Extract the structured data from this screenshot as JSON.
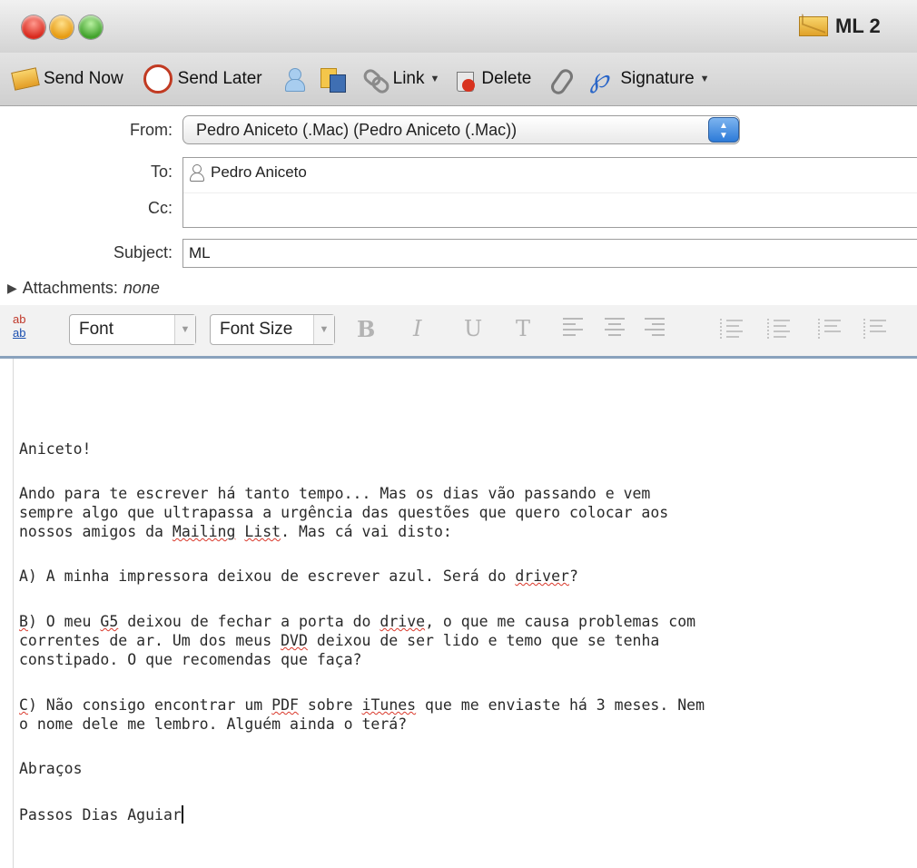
{
  "window": {
    "title": "ML 2"
  },
  "toolbar": {
    "send_now": "Send Now",
    "send_later": "Send Later",
    "link": "Link",
    "delete": "Delete",
    "signature": "Signature"
  },
  "header": {
    "from_label": "From:",
    "from_value": "Pedro Aniceto (.Mac) (Pedro Aniceto (.Mac))",
    "to_label": "To:",
    "to_recipient": "Pedro Aniceto",
    "cc_label": "Cc:",
    "subject_label": "Subject:",
    "subject_value": "ML",
    "attachments_label": "Attachments:",
    "attachments_value": "none"
  },
  "format_bar": {
    "spell_top": "ab",
    "spell_bottom": "ab",
    "font_select": "Font",
    "font_size_select": "Font Size",
    "bold": "B",
    "italic": "I",
    "underline": "U",
    "text_color": "T"
  },
  "message": {
    "greeting": "Aniceto!",
    "p1_l1": "Ando para te escrever há tanto tempo... Mas os dias vão passando e vem",
    "p1_l2": "sempre algo que ultrapassa a urgência das questões que quero colocar aos",
    "p1_l3_a": "nossos amigos da ",
    "p1_l3_b": "Mailing",
    "p1_l3_c": " ",
    "p1_l3_d": "List",
    "p1_l3_e": ". Mas cá vai disto:",
    "a_line_a": "A) A minha impressora deixou de escrever azul. Será do ",
    "a_line_b": "driver",
    "a_line_c": "?",
    "b_l1_a": "B",
    "b_l1_b": ") O meu ",
    "b_l1_c": "G5",
    "b_l1_d": " deixou de fechar a porta do ",
    "b_l1_e": "drive",
    "b_l1_f": ", o que me causa problemas com",
    "b_l2_a": "correntes de ar. Um dos meus ",
    "b_l2_b": "DVD",
    "b_l2_c": " deixou de ser lido e temo que se tenha",
    "b_l3": "constipado. O que recomendas que faça?",
    "c_l1_a": "C",
    "c_l1_b": ") Não consigo encontrar um ",
    "c_l1_c": "PDF",
    "c_l1_d": " sobre ",
    "c_l1_e": "iTunes",
    "c_l1_f": " que me enviaste há 3 meses. Nem",
    "c_l2": "o nome dele me lembro. Alguém ainda o terá?",
    "closing": "Abraços",
    "signature": "Passos Dias Aguiar"
  },
  "colors": {
    "accent": "#2c7ad8",
    "spell_error": "#d9382b",
    "body_rule": "#8aa2bd"
  },
  "icons": [
    "close-light",
    "minimize-light",
    "zoom-light",
    "envelope-icon",
    "send-now-icon",
    "send-later-icon",
    "address-book-icon",
    "attach-file-icon",
    "link-icon",
    "delete-icon",
    "paperclip-icon",
    "signature-icon",
    "spelling-icon",
    "align-left-icon",
    "align-center-icon",
    "align-right-icon",
    "list-icon",
    "indent-icon"
  ]
}
